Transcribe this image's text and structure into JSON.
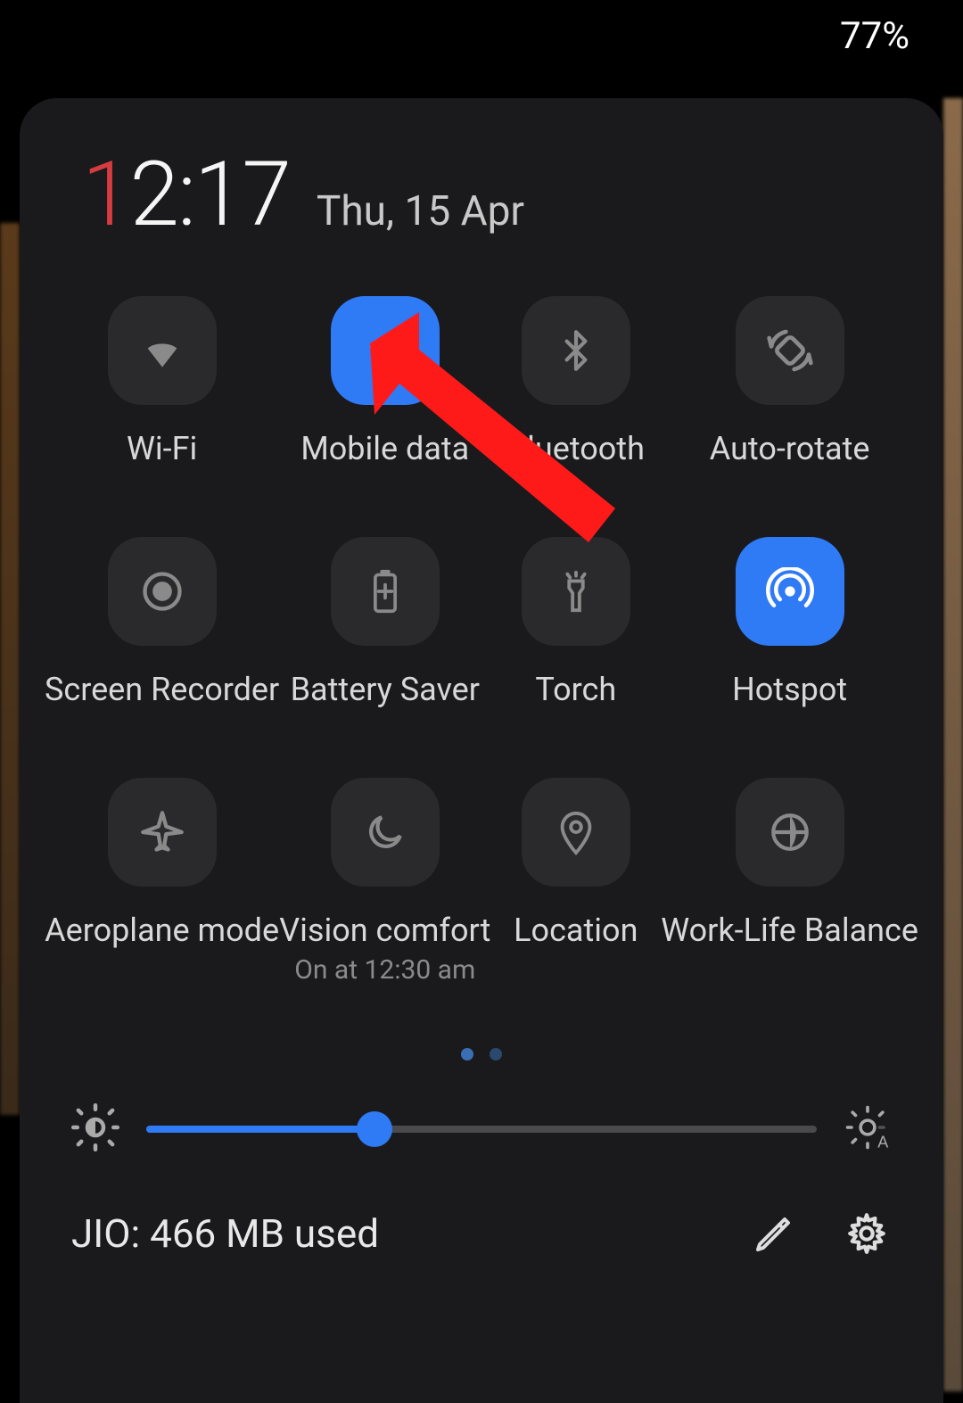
{
  "status": {
    "battery_pct": "77%"
  },
  "clock": {
    "first_digit": "1",
    "rest": "2:17",
    "date": "Thu, 15 Apr"
  },
  "tiles": [
    {
      "id": "wifi",
      "label": "Wi-Fi",
      "icon": "wifi-icon",
      "active": false
    },
    {
      "id": "mobile-data",
      "label": "Mobile data",
      "icon": "mobile-data-icon",
      "active": true
    },
    {
      "id": "bluetooth",
      "label": "Bluetooth",
      "icon": "bluetooth-icon",
      "active": false
    },
    {
      "id": "auto-rotate",
      "label": "Auto-rotate",
      "icon": "auto-rotate-icon",
      "active": false
    },
    {
      "id": "screen-recorder",
      "label": "Screen Recorder",
      "icon": "record-icon",
      "active": false
    },
    {
      "id": "battery-saver",
      "label": "Battery Saver",
      "icon": "battery-saver-icon",
      "active": false
    },
    {
      "id": "torch",
      "label": "Torch",
      "icon": "torch-icon",
      "active": false
    },
    {
      "id": "hotspot",
      "label": "Hotspot",
      "icon": "hotspot-icon",
      "active": true
    },
    {
      "id": "aeroplane-mode",
      "label": "Aeroplane mode",
      "icon": "airplane-icon",
      "active": false
    },
    {
      "id": "vision-comfort",
      "label": "Vision comfort",
      "icon": "moon-icon",
      "active": false,
      "sub": "On at 12:30 am"
    },
    {
      "id": "location",
      "label": "Location",
      "icon": "location-icon",
      "active": false
    },
    {
      "id": "work-life",
      "label": "Work-Life Balance",
      "icon": "globe-icon",
      "active": false
    }
  ],
  "pager": {
    "pages": 2,
    "current": 0
  },
  "brightness": {
    "percent": 34
  },
  "footer": {
    "carrier_usage": "JIO: 466 MB used"
  },
  "colors": {
    "accent": "#2f7af5",
    "accent_red": "#d63b3f",
    "tile_bg": "#2a2a2c",
    "panel_bg": "#1a1a1c"
  },
  "annotation": {
    "arrow_points_to": "mobile-data"
  }
}
